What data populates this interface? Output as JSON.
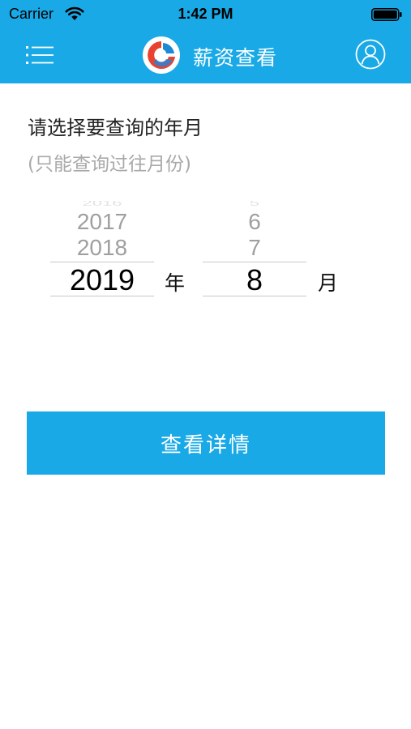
{
  "status_bar": {
    "carrier": "Carrier",
    "time": "1:42 PM"
  },
  "nav": {
    "title": "薪资查看",
    "menu_icon": "list-menu-icon",
    "profile_icon": "user-profile-icon",
    "logo_icon": "app-logo-icon"
  },
  "form": {
    "prompt": "请选择要查询的年月",
    "hint": "(只能查询过往月份)",
    "year_unit": "年",
    "month_unit": "月"
  },
  "year_picker": {
    "faint": "2016",
    "far": "2017",
    "near": "2018",
    "selected": "2019"
  },
  "month_picker": {
    "faint": "5",
    "far": "6",
    "near": "7",
    "selected": "8"
  },
  "actions": {
    "detail_label": "查看详情"
  },
  "colors": {
    "brand": "#19a9e6",
    "text": "#222222",
    "hint": "#a9a9a9"
  }
}
